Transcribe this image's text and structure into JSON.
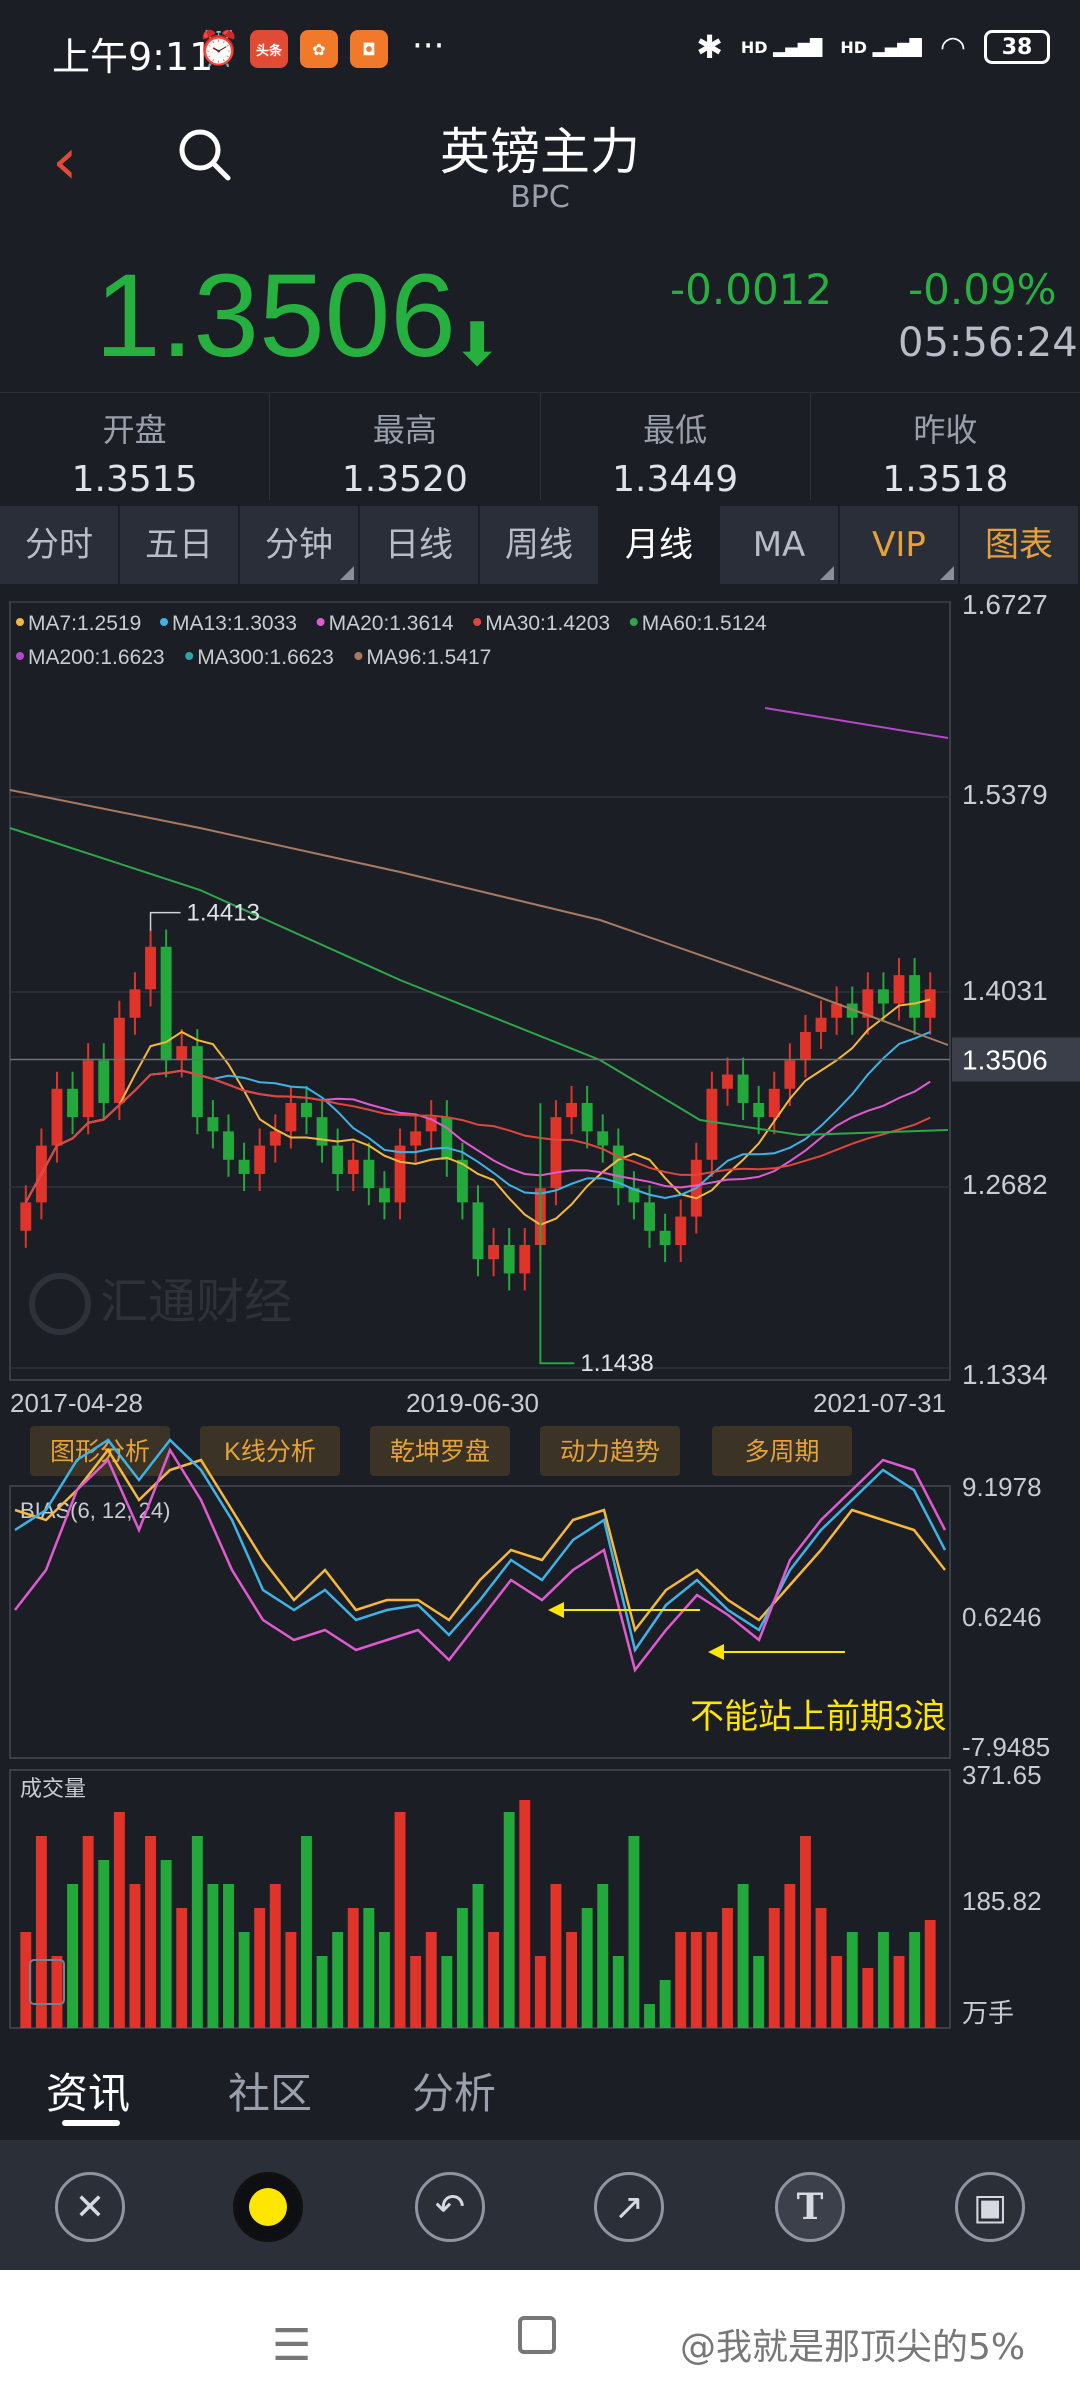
{
  "status_bar": {
    "time": "上午9:11",
    "more": "···",
    "app_icons": [
      {
        "name": "alarm-icon",
        "label": "⏰",
        "color": "#ffffff"
      },
      {
        "name": "toutiao-icon",
        "label": "头条",
        "color": "#e14b36"
      },
      {
        "name": "app-orange-icon",
        "label": "✿",
        "color": "#f07a2a"
      },
      {
        "name": "app-bag-icon",
        "label": "◘",
        "color": "#f07a2a"
      }
    ],
    "signal1": "HD",
    "signal2": "HD",
    "battery": "38"
  },
  "header": {
    "title": "英镑主力",
    "code": "BPC"
  },
  "quote": {
    "price": "1.3506",
    "arrow": "⬇",
    "change": "-0.0012",
    "change_pct": "-0.09%",
    "time": "05:56:24"
  },
  "stats": [
    {
      "label": "开盘",
      "value": "1.3515"
    },
    {
      "label": "最高",
      "value": "1.3520"
    },
    {
      "label": "最低",
      "value": "1.3449"
    },
    {
      "label": "昨收",
      "value": "1.3518"
    }
  ],
  "tabs": [
    {
      "label": "分时",
      "active": false,
      "menu": false
    },
    {
      "label": "五日",
      "active": false,
      "menu": false
    },
    {
      "label": "分钟",
      "active": false,
      "menu": true
    },
    {
      "label": "日线",
      "active": false,
      "menu": false
    },
    {
      "label": "周线",
      "active": false,
      "menu": false
    },
    {
      "label": "月线",
      "active": true,
      "menu": false
    },
    {
      "label": "MA",
      "active": false,
      "menu": true
    },
    {
      "label": "VIP",
      "active": false,
      "menu": true
    },
    {
      "label": "图表",
      "active": false,
      "menu": false
    }
  ],
  "chart_data": [
    {
      "type": "candlestick",
      "legend": [
        {
          "label": "MA7:1.2519",
          "color": "#f5b83a"
        },
        {
          "label": "MA13:1.3033",
          "color": "#3fb3e6"
        },
        {
          "label": "MA20:1.3614",
          "color": "#e05bd0"
        },
        {
          "label": "MA30:1.4203",
          "color": "#e0463a"
        },
        {
          "label": "MA60:1.5124",
          "color": "#2fa64a"
        },
        {
          "label": "MA200:1.6623",
          "color": "#b548c9"
        },
        {
          "label": "MA300:1.6623",
          "color": "#2aa6a6"
        },
        {
          "label": "MA96:1.5417",
          "color": "#a87a62"
        }
      ],
      "y_ticks": [
        "1.6727",
        "1.5379",
        "1.4031",
        "1.2682",
        "1.1334"
      ],
      "current_price_tag": "1.3506",
      "x_ticks": [
        "2017-04-28",
        "2019-06-30",
        "2021-07-31"
      ],
      "annotations": [
        {
          "text": "1.4413",
          "kind": "high"
        },
        {
          "text": "1.1438",
          "kind": "low"
        }
      ],
      "ylim": [
        1.1334,
        1.6727
      ],
      "watermark": "汇通财经"
    },
    {
      "type": "line",
      "title": "BIAS(6, 12, 24)",
      "y_ticks": [
        "9.1978",
        "0.6246",
        "-7.9485"
      ],
      "series_colors": [
        "#f5b83a",
        "#3fb3e6",
        "#e05bd0"
      ],
      "note": "不能站上前期3浪"
    },
    {
      "type": "bar",
      "title": "成交量",
      "y_ticks": [
        "371.65",
        "185.82"
      ],
      "unit": "万手"
    }
  ],
  "analysis_buttons": [
    "图形分析",
    "K线分析",
    "乾坤罗盘",
    "动力趋势",
    "多周期"
  ],
  "bottom_tabs": [
    "资讯",
    "社区",
    "分析"
  ],
  "toolbar": {
    "close": "✕",
    "undo": "↶",
    "arrow": "↗",
    "text": "T",
    "save": "▣",
    "pen_color": "#ffe600"
  },
  "navbar": {
    "menu": "☰",
    "watermark": "@我就是那顶尖的5%"
  }
}
